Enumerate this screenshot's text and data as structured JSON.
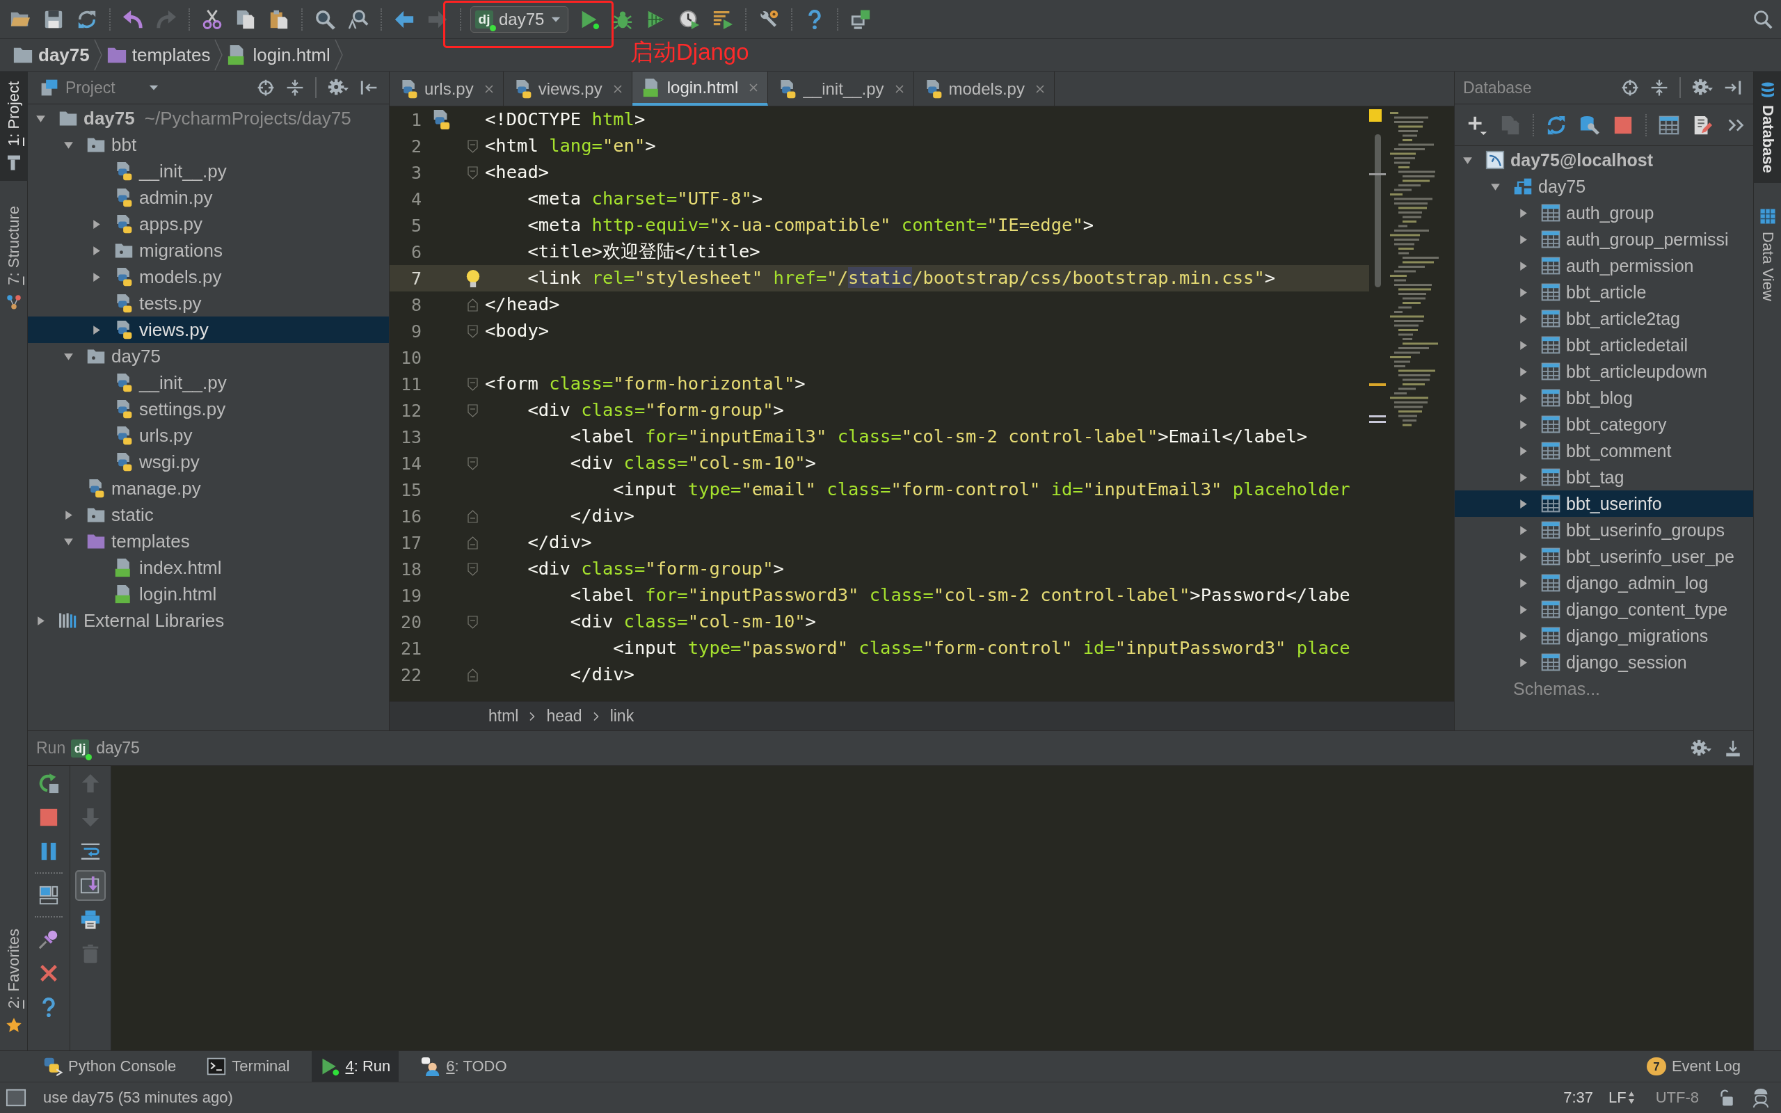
{
  "toolbar": {
    "left_groups": [
      [
        {
          "kind": "open",
          "disabled": false
        },
        {
          "kind": "save",
          "disabled": false
        },
        {
          "kind": "sync",
          "disabled": false
        }
      ],
      [
        {
          "kind": "undo",
          "disabled": false
        },
        {
          "kind": "redo",
          "disabled": true
        }
      ],
      [
        {
          "kind": "cut",
          "disabled": false
        },
        {
          "kind": "copy",
          "disabled": false
        },
        {
          "kind": "paste",
          "disabled": false
        }
      ],
      [
        {
          "kind": "find",
          "disabled": false
        },
        {
          "kind": "replace",
          "disabled": false
        }
      ],
      [
        {
          "kind": "back",
          "disabled": false
        },
        {
          "kind": "forward",
          "disabled": true
        }
      ]
    ],
    "run_config": {
      "logo": "dj",
      "label": "day75",
      "running": true
    },
    "right_groups": [
      [
        {
          "kind": "run",
          "disabled": false
        },
        {
          "kind": "debug",
          "disabled": false
        },
        {
          "kind": "coverage",
          "disabled": false
        },
        {
          "kind": "profile",
          "disabled": false
        },
        {
          "kind": "concurrency",
          "disabled": false
        }
      ],
      [
        {
          "kind": "settings",
          "disabled": false
        }
      ],
      [
        {
          "kind": "help",
          "disabled": false
        }
      ],
      [
        {
          "kind": "structure",
          "disabled": false
        }
      ]
    ]
  },
  "annotation": {
    "text": "启动Django"
  },
  "navbar": {
    "items": [
      {
        "label": "day75",
        "kind": "project"
      },
      {
        "label": "templates",
        "kind": "templates"
      },
      {
        "label": "login.html",
        "kind": "html"
      }
    ]
  },
  "left_stripe": {
    "top": [
      {
        "label": "1: Project",
        "kind": "project",
        "selected": true,
        "mnemonic": true
      },
      {
        "label": "7: Structure",
        "kind": "structure",
        "selected": false,
        "mnemonic": true
      }
    ],
    "bottom": [
      {
        "label": "2: Favorites",
        "kind": "favorites",
        "selected": false,
        "mnemonic": true
      }
    ]
  },
  "project_panel": {
    "title": "Project",
    "tree": [
      {
        "label": "day75",
        "path": "~/PycharmProjects/day75",
        "kind": "project",
        "expanded": true,
        "selected": false,
        "children": [
          {
            "label": "bbt",
            "kind": "package",
            "expanded": true,
            "selected": false,
            "children": [
              {
                "label": "__init__.py",
                "kind": "python",
                "selected": false
              },
              {
                "label": "admin.py",
                "kind": "python",
                "selected": false
              },
              {
                "label": "apps.py",
                "kind": "python",
                "expanded": false,
                "selected": false
              },
              {
                "label": "migrations",
                "kind": "package",
                "expanded": false,
                "selected": false
              },
              {
                "label": "models.py",
                "kind": "python",
                "expanded": false,
                "selected": false
              },
              {
                "label": "tests.py",
                "kind": "python",
                "selected": false
              },
              {
                "label": "views.py",
                "kind": "python",
                "expanded": false,
                "selected": true
              }
            ]
          },
          {
            "label": "day75",
            "kind": "package",
            "expanded": true,
            "selected": false,
            "children": [
              {
                "label": "__init__.py",
                "kind": "python",
                "selected": false
              },
              {
                "label": "settings.py",
                "kind": "python",
                "selected": false
              },
              {
                "label": "urls.py",
                "kind": "python",
                "selected": false
              },
              {
                "label": "wsgi.py",
                "kind": "python",
                "selected": false
              }
            ]
          },
          {
            "label": "manage.py",
            "kind": "python",
            "selected": false
          },
          {
            "label": "static",
            "kind": "package",
            "expanded": false,
            "selected": false
          },
          {
            "label": "templates",
            "kind": "templates",
            "expanded": true,
            "selected": false,
            "children": [
              {
                "label": "index.html",
                "kind": "html",
                "selected": false
              },
              {
                "label": "login.html",
                "kind": "html",
                "selected": false
              }
            ]
          }
        ]
      },
      {
        "label": "External Libraries",
        "kind": "libraries",
        "expanded": false,
        "selected": false
      }
    ]
  },
  "editor": {
    "tabs": [
      {
        "label": "urls.py",
        "kind": "python",
        "selected": false
      },
      {
        "label": "views.py",
        "kind": "python",
        "selected": false
      },
      {
        "label": "login.html",
        "kind": "html",
        "selected": true
      },
      {
        "label": "__init__.py",
        "kind": "python",
        "selected": false
      },
      {
        "label": "models.py",
        "kind": "python",
        "selected": false
      }
    ],
    "lines": [
      {
        "number": "1",
        "current": false,
        "marker": {
          "kind": "python"
        },
        "tokens": [
          {
            "kind": "tag",
            "text": "<!DOCTYPE "
          },
          {
            "kind": "attr",
            "text": "html"
          },
          {
            "kind": "tag",
            "text": ">"
          }
        ]
      },
      {
        "number": "2",
        "current": false,
        "marker": {
          "kind": "fold_start"
        },
        "tokens": [
          {
            "kind": "tag",
            "text": "<html "
          },
          {
            "kind": "attr",
            "text": "lang="
          },
          {
            "kind": "value",
            "text": "\"en\""
          },
          {
            "kind": "tag",
            "text": ">"
          }
        ]
      },
      {
        "number": "3",
        "current": false,
        "marker": {
          "kind": "fold_start"
        },
        "tokens": [
          {
            "kind": "tag",
            "text": "<head>"
          }
        ]
      },
      {
        "number": "4",
        "current": false,
        "tokens": [
          {
            "kind": "tag",
            "text": "    <meta "
          },
          {
            "kind": "attr",
            "text": "charset="
          },
          {
            "kind": "value",
            "text": "\"UTF-8\""
          },
          {
            "kind": "tag",
            "text": ">"
          }
        ]
      },
      {
        "number": "5",
        "current": false,
        "tokens": [
          {
            "kind": "tag",
            "text": "    <meta "
          },
          {
            "kind": "attr",
            "text": "http-equiv="
          },
          {
            "kind": "value",
            "text": "\"x-ua-compatible\""
          },
          {
            "kind": "attr",
            "text": " content="
          },
          {
            "kind": "value",
            "text": "\"IE=edge\""
          },
          {
            "kind": "tag",
            "text": ">"
          }
        ]
      },
      {
        "number": "6",
        "current": false,
        "tokens": [
          {
            "kind": "tag",
            "text": "    <title>"
          },
          {
            "kind": "text",
            "text": "欢迎登陆"
          },
          {
            "kind": "tag",
            "text": "</title>"
          }
        ]
      },
      {
        "number": "7",
        "current": true,
        "marker": {
          "kind": "bulb"
        },
        "tokens": [
          {
            "kind": "tag",
            "text": "    <link "
          },
          {
            "kind": "attr",
            "text": "rel="
          },
          {
            "kind": "value",
            "text": "\"stylesheet\""
          },
          {
            "kind": "attr",
            "text": " href="
          },
          {
            "kind": "value",
            "text": "\"/"
          },
          {
            "kind": "match",
            "text": "static"
          },
          {
            "kind": "value",
            "text": "/bootstrap/css/bootstrap.min.css\""
          },
          {
            "kind": "tag",
            "text": ">"
          }
        ]
      },
      {
        "number": "8",
        "current": false,
        "marker": {
          "kind": "fold_end"
        },
        "tokens": [
          {
            "kind": "tag",
            "text": "</head>"
          }
        ]
      },
      {
        "number": "9",
        "current": false,
        "marker": {
          "kind": "fold_start"
        },
        "tokens": [
          {
            "kind": "tag",
            "text": "<body>"
          }
        ]
      },
      {
        "number": "10",
        "current": false
      },
      {
        "number": "11",
        "current": false,
        "marker": {
          "kind": "fold_start"
        },
        "tokens": [
          {
            "kind": "tag",
            "text": "<form "
          },
          {
            "kind": "attr",
            "text": "class="
          },
          {
            "kind": "value",
            "text": "\"form-horizontal\""
          },
          {
            "kind": "tag",
            "text": ">"
          }
        ]
      },
      {
        "number": "12",
        "current": false,
        "marker": {
          "kind": "fold_start"
        },
        "tokens": [
          {
            "kind": "tag",
            "text": "    <div "
          },
          {
            "kind": "attr",
            "text": "class="
          },
          {
            "kind": "value",
            "text": "\"form-group\""
          },
          {
            "kind": "tag",
            "text": ">"
          }
        ]
      },
      {
        "number": "13",
        "current": false,
        "tokens": [
          {
            "kind": "tag",
            "text": "        <label "
          },
          {
            "kind": "attr",
            "text": "for="
          },
          {
            "kind": "value",
            "text": "\"inputEmail3\""
          },
          {
            "kind": "attr",
            "text": " class="
          },
          {
            "kind": "value",
            "text": "\"col-sm-2 control-label\""
          },
          {
            "kind": "tag",
            "text": ">"
          },
          {
            "kind": "text",
            "text": "Email"
          },
          {
            "kind": "tag",
            "text": "</label>"
          }
        ]
      },
      {
        "number": "14",
        "current": false,
        "marker": {
          "kind": "fold_start"
        },
        "tokens": [
          {
            "kind": "tag",
            "text": "        <div "
          },
          {
            "kind": "attr",
            "text": "class="
          },
          {
            "kind": "value",
            "text": "\"col-sm-10\""
          },
          {
            "kind": "tag",
            "text": ">"
          }
        ]
      },
      {
        "number": "15",
        "current": false,
        "tokens": [
          {
            "kind": "tag",
            "text": "            <input "
          },
          {
            "kind": "attr",
            "text": "type="
          },
          {
            "kind": "value",
            "text": "\"email\""
          },
          {
            "kind": "attr",
            "text": " class="
          },
          {
            "kind": "value",
            "text": "\"form-control\""
          },
          {
            "kind": "attr",
            "text": " id="
          },
          {
            "kind": "value",
            "text": "\"inputEmail3\""
          },
          {
            "kind": "attr",
            "text": " placeholder"
          }
        ]
      },
      {
        "number": "16",
        "current": false,
        "marker": {
          "kind": "fold_end"
        },
        "tokens": [
          {
            "kind": "tag",
            "text": "        </div>"
          }
        ]
      },
      {
        "number": "17",
        "current": false,
        "marker": {
          "kind": "fold_end"
        },
        "tokens": [
          {
            "kind": "tag",
            "text": "    </div>"
          }
        ]
      },
      {
        "number": "18",
        "current": false,
        "marker": {
          "kind": "fold_start"
        },
        "tokens": [
          {
            "kind": "tag",
            "text": "    <div "
          },
          {
            "kind": "attr",
            "text": "class="
          },
          {
            "kind": "value",
            "text": "\"form-group\""
          },
          {
            "kind": "tag",
            "text": ">"
          }
        ]
      },
      {
        "number": "19",
        "current": false,
        "tokens": [
          {
            "kind": "tag",
            "text": "        <label "
          },
          {
            "kind": "attr",
            "text": "for="
          },
          {
            "kind": "value",
            "text": "\"inputPassword3\""
          },
          {
            "kind": "attr",
            "text": " class="
          },
          {
            "kind": "value",
            "text": "\"col-sm-2 control-label\""
          },
          {
            "kind": "tag",
            "text": ">"
          },
          {
            "kind": "text",
            "text": "Password"
          },
          {
            "kind": "tag",
            "text": "</labe"
          }
        ]
      },
      {
        "number": "20",
        "current": false,
        "marker": {
          "kind": "fold_start"
        },
        "tokens": [
          {
            "kind": "tag",
            "text": "        <div "
          },
          {
            "kind": "attr",
            "text": "class="
          },
          {
            "kind": "value",
            "text": "\"col-sm-10\""
          },
          {
            "kind": "tag",
            "text": ">"
          }
        ]
      },
      {
        "number": "21",
        "current": false,
        "tokens": [
          {
            "kind": "tag",
            "text": "            <input "
          },
          {
            "kind": "attr",
            "text": "type="
          },
          {
            "kind": "value",
            "text": "\"password\""
          },
          {
            "kind": "attr",
            "text": " class="
          },
          {
            "kind": "value",
            "text": "\"form-control\""
          },
          {
            "kind": "attr",
            "text": " id="
          },
          {
            "kind": "value",
            "text": "\"inputPassword3\""
          },
          {
            "kind": "attr",
            "text": " place"
          }
        ]
      },
      {
        "number": "22",
        "current": false,
        "marker": {
          "kind": "fold_end"
        },
        "tokens": [
          {
            "kind": "tag",
            "text": "        </div>"
          }
        ]
      }
    ],
    "breadcrumbs": [
      "html",
      "head",
      "link"
    ]
  },
  "database_panel": {
    "title": "Database",
    "toolbar": [
      [
        {
          "kind": "add",
          "disabled": false
        },
        {
          "kind": "copy",
          "disabled": true
        }
      ],
      [
        {
          "kind": "refresh",
          "disabled": false
        },
        {
          "kind": "properties",
          "disabled": false
        },
        {
          "kind": "stop",
          "disabled": false
        }
      ],
      [
        {
          "kind": "table",
          "disabled": false
        },
        {
          "kind": "edit",
          "disabled": false
        },
        {
          "kind": "more",
          "disabled": false
        }
      ]
    ],
    "tree": [
      {
        "label": "day75@localhost",
        "kind": "datasource",
        "expanded": true,
        "selected": false,
        "children": [
          {
            "label": "day75",
            "kind": "schema",
            "expanded": true,
            "selected": false,
            "children": [
              {
                "label": "auth_group",
                "kind": "table",
                "expanded": false,
                "selected": false
              },
              {
                "label": "auth_group_permissi",
                "kind": "table",
                "expanded": false,
                "selected": false
              },
              {
                "label": "auth_permission",
                "kind": "table",
                "expanded": false,
                "selected": false
              },
              {
                "label": "bbt_article",
                "kind": "table",
                "expanded": false,
                "selected": false
              },
              {
                "label": "bbt_article2tag",
                "kind": "table",
                "expanded": false,
                "selected": false
              },
              {
                "label": "bbt_articledetail",
                "kind": "table",
                "expanded": false,
                "selected": false
              },
              {
                "label": "bbt_articleupdown",
                "kind": "table",
                "expanded": false,
                "selected": false
              },
              {
                "label": "bbt_blog",
                "kind": "table",
                "expanded": false,
                "selected": false
              },
              {
                "label": "bbt_category",
                "kind": "table",
                "expanded": false,
                "selected": false
              },
              {
                "label": "bbt_comment",
                "kind": "table",
                "expanded": false,
                "selected": false
              },
              {
                "label": "bbt_tag",
                "kind": "table",
                "expanded": false,
                "selected": false
              },
              {
                "label": "bbt_userinfo",
                "kind": "table",
                "expanded": false,
                "selected": true
              },
              {
                "label": "bbt_userinfo_groups",
                "kind": "table",
                "expanded": false,
                "selected": false
              },
              {
                "label": "bbt_userinfo_user_pe",
                "kind": "table",
                "expanded": false,
                "selected": false
              },
              {
                "label": "django_admin_log",
                "kind": "table",
                "expanded": false,
                "selected": false
              },
              {
                "label": "django_content_type",
                "kind": "table",
                "expanded": false,
                "selected": false
              },
              {
                "label": "django_migrations",
                "kind": "table",
                "expanded": false,
                "selected": false
              },
              {
                "label": "django_session",
                "kind": "table",
                "expanded": false,
                "selected": false
              }
            ]
          },
          {
            "label": "Schemas...",
            "kind": "more",
            "selected": false
          }
        ]
      }
    ]
  },
  "right_stripe": {
    "tabs": [
      {
        "label": "Database",
        "kind": "database",
        "selected": true
      },
      {
        "label": "Data View",
        "kind": "dataview",
        "selected": false
      }
    ]
  },
  "run_panel": {
    "title": "Run",
    "config": {
      "logo": "dj",
      "label": "day75",
      "running": true
    },
    "actions": [
      [
        {
          "kind": "rerun",
          "disabled": false
        },
        {
          "kind": "stop",
          "disabled": false
        },
        {
          "kind": "pause",
          "disabled": false
        }
      ],
      [
        {
          "kind": "layout",
          "disabled": false
        }
      ],
      [
        {
          "kind": "pin",
          "disabled": false
        },
        {
          "kind": "close",
          "disabled": false
        },
        {
          "kind": "help",
          "disabled": false
        }
      ]
    ],
    "console_actions": [
      {
        "kind": "up",
        "disabled": true,
        "on": false
      },
      {
        "kind": "down",
        "disabled": true,
        "on": false
      },
      {
        "kind": "wrap",
        "disabled": false,
        "on": false
      },
      {
        "kind": "scroll_end",
        "disabled": false,
        "on": true
      },
      {
        "kind": "print",
        "disabled": false,
        "on": false
      },
      {
        "kind": "clear",
        "disabled": true,
        "on": false
      }
    ]
  },
  "tool_windows": {
    "tabs": [
      {
        "label": "Python Console",
        "kind": "python_console",
        "selected": false,
        "mnemonic": false
      },
      {
        "label": "Terminal",
        "kind": "terminal",
        "selected": false,
        "mnemonic": false
      },
      {
        "label": "4: Run",
        "kind": "run",
        "selected": true,
        "mnemonic": true
      },
      {
        "label": "6: TODO",
        "kind": "todo",
        "selected": false,
        "mnemonic": true
      }
    ],
    "event_log": {
      "label": "Event Log",
      "count": "7"
    }
  },
  "status_bar": {
    "message": "use day75 (53 minutes ago)",
    "position": "7:37",
    "line_separator": "LF",
    "encoding": "UTF-8"
  }
}
